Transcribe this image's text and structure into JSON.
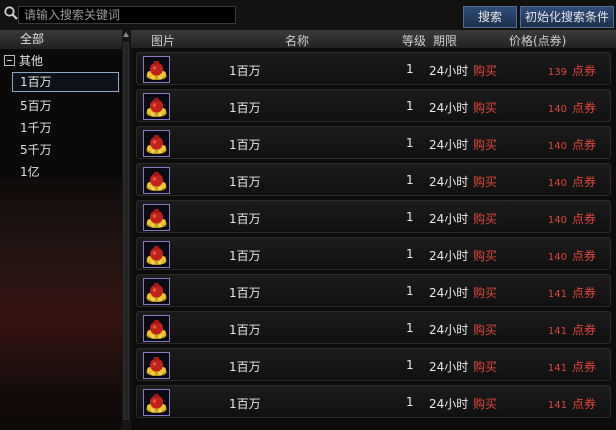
{
  "search": {
    "placeholder": "请输入搜索关键词",
    "search_label": "搜索",
    "reset_label": "初始化搜索条件"
  },
  "categories": {
    "all_label": "全部",
    "group_label": "其他",
    "items": [
      "1百万",
      "5百万",
      "1千万",
      "5千万",
      "1亿"
    ]
  },
  "table": {
    "headers": {
      "image": "图片",
      "name": "名称",
      "level": "等级",
      "period": "期限",
      "price": "价格(点券)"
    },
    "rows": [
      {
        "name": "1百万",
        "level": "1",
        "period": "24小时",
        "action": "购买",
        "price": "139",
        "unit": "点券"
      },
      {
        "name": "1百万",
        "level": "1",
        "period": "24小时",
        "action": "购买",
        "price": "140",
        "unit": "点券"
      },
      {
        "name": "1百万",
        "level": "1",
        "period": "24小时",
        "action": "购买",
        "price": "140",
        "unit": "点券"
      },
      {
        "name": "1百万",
        "level": "1",
        "period": "24小时",
        "action": "购买",
        "price": "140",
        "unit": "点券"
      },
      {
        "name": "1百万",
        "level": "1",
        "period": "24小时",
        "action": "购买",
        "price": "140",
        "unit": "点券"
      },
      {
        "name": "1百万",
        "level": "1",
        "period": "24小时",
        "action": "购买",
        "price": "140",
        "unit": "点券"
      },
      {
        "name": "1百万",
        "level": "1",
        "period": "24小时",
        "action": "购买",
        "price": "141",
        "unit": "点券"
      },
      {
        "name": "1百万",
        "level": "1",
        "period": "24小时",
        "action": "购买",
        "price": "141",
        "unit": "点券"
      },
      {
        "name": "1百万",
        "level": "1",
        "period": "24小时",
        "action": "购买",
        "price": "141",
        "unit": "点券"
      },
      {
        "name": "1百万",
        "level": "1",
        "period": "24小时",
        "action": "购买",
        "price": "141",
        "unit": "点券"
      }
    ]
  },
  "colors": {
    "accent_red": "#e0453a",
    "button_blue": "#2e4e78",
    "icon_border": "#8a7abf"
  },
  "icons": {
    "search": "magnifier-icon",
    "item": "gold-pouch-icon"
  }
}
